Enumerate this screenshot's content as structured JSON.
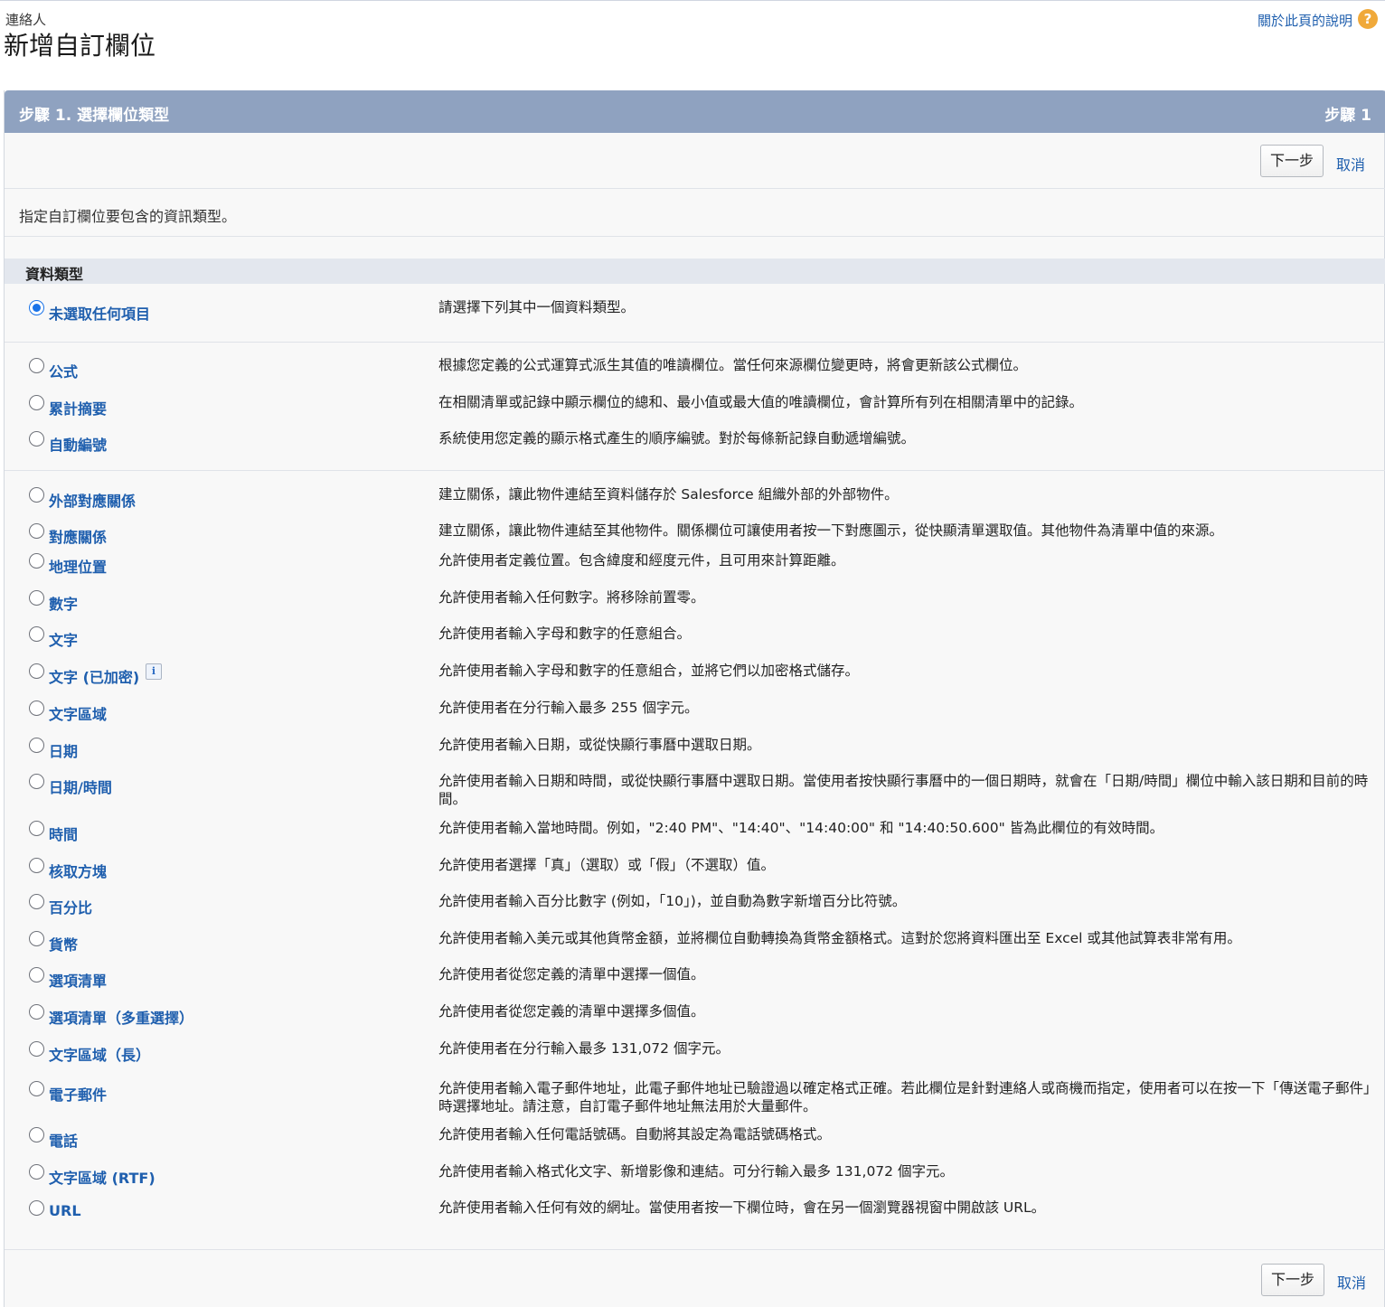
{
  "header": {
    "breadcrumb": "連絡人",
    "title": "新增自訂欄位",
    "help_link": "關於此頁的說明",
    "help_icon": "?"
  },
  "step": {
    "title": "步驟 1. 選擇欄位類型",
    "indicator": "步驟 1"
  },
  "actions": {
    "next_label": "下一步",
    "cancel_label": "取消"
  },
  "instruction": "指定自訂欄位要包含的資訊類型。",
  "section": {
    "title": "資料類型"
  },
  "options": [
    {
      "label": "未選取任何項目",
      "desc": "請選擇下列其中一個資料類型。",
      "checked": true
    },
    {
      "label": "公式",
      "desc": "根據您定義的公式運算式派生其值的唯讀欄位。當任何來源欄位變更時，將會更新該公式欄位。"
    },
    {
      "label": "累計摘要",
      "desc": "在相關清單或記錄中顯示欄位的總和、最小值或最大值的唯讀欄位，會計算所有列在相關清單中的記錄。"
    },
    {
      "label": "自動編號",
      "desc": "系統使用您定義的顯示格式產生的順序編號。對於每條新記錄自動遞增編號。"
    },
    {
      "label": "外部對應關係",
      "desc": "建立關係，讓此物件連結至資料儲存於 Salesforce 組織外部的外部物件。"
    },
    {
      "label": "對應關係",
      "desc": "建立關係，讓此物件連結至其他物件。關係欄位可讓使用者按一下對應圖示，從快顯清單選取值。其他物件為清單中值的來源。"
    },
    {
      "label": "地理位置",
      "desc": "允許使用者定義位置。包含緯度和經度元件，且可用來計算距離。"
    },
    {
      "label": "數字",
      "desc": "允許使用者輸入任何數字。將移除前置零。"
    },
    {
      "label": "文字",
      "desc": "允許使用者輸入字母和數字的任意組合。"
    },
    {
      "label": "文字 (已加密)",
      "desc": "允許使用者輸入字母和數字的任意組合，並將它們以加密格式儲存。",
      "info": "i"
    },
    {
      "label": "文字區域",
      "desc": "允許使用者在分行輸入最多 255 個字元。"
    },
    {
      "label": "日期",
      "desc": "允許使用者輸入日期，或從快顯行事曆中選取日期。"
    },
    {
      "label": "日期/時間",
      "desc": "允許使用者輸入日期和時間，或從快顯行事曆中選取日期。當使用者按快顯行事曆中的一個日期時，就會在「日期/時間」欄位中輸入該日期和目前的時間。"
    },
    {
      "label": "時間",
      "desc": "允許使用者輸入當地時間。例如，\"2:40 PM\"、\"14:40\"、\"14:40:00\" 和 \"14:40:50.600\" 皆為此欄位的有效時間。"
    },
    {
      "label": "核取方塊",
      "desc": "允許使用者選擇「真」（選取）或「假」（不選取）值。"
    },
    {
      "label": "百分比",
      "desc": "允許使用者輸入百分比數字 (例如，「10」)，並自動為數字新增百分比符號。"
    },
    {
      "label": "貨幣",
      "desc": "允許使用者輸入美元或其他貨幣金額，並將欄位自動轉換為貨幣金額格式。這對於您將資料匯出至 Excel 或其他試算表非常有用。"
    },
    {
      "label": "選項清單",
      "desc": "允許使用者從您定義的清單中選擇一個值。"
    },
    {
      "label": "選項清單（多重選擇）",
      "desc": "允許使用者從您定義的清單中選擇多個值。"
    },
    {
      "label": "文字區域（長）",
      "desc": "允許使用者在分行輸入最多 131,072 個字元。"
    },
    {
      "label": "電子郵件",
      "desc": "允許使用者輸入電子郵件地址，此電子郵件地址已驗證過以確定格式正確。若此欄位是針對連絡人或商機而指定，使用者可以在按一下「傳送電子郵件」時選擇地址。請注意，自訂電子郵件地址無法用於大量郵件。"
    },
    {
      "label": "電話",
      "desc": "允許使用者輸入任何電話號碼。自動將其設定為電話號碼格式。"
    },
    {
      "label": "文字區域 (RTF)",
      "desc": "允許使用者輸入格式化文字、新增影像和連結。可分行輸入最多 131,072 個字元。"
    },
    {
      "label": "URL",
      "desc": "允許使用者輸入任何有效的網址。當使用者按一下欄位時，會在另一個瀏覽器視窗中開啟該 URL。"
    }
  ]
}
